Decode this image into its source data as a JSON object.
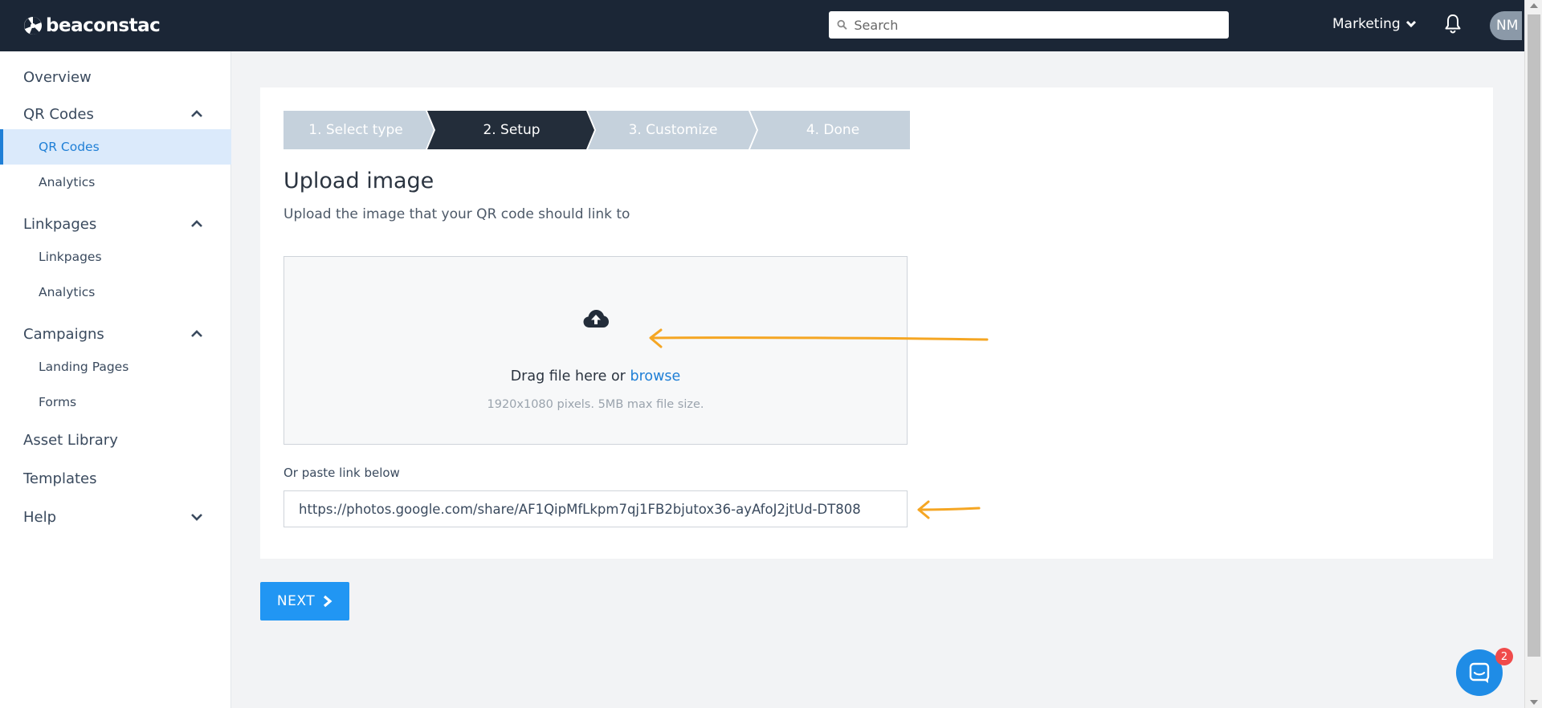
{
  "app": {
    "brand": "beaconstac"
  },
  "header": {
    "search_placeholder": "Search",
    "org_name": "Marketing",
    "avatar_initials": "NM",
    "icons": [
      "search-icon",
      "chevron-down-icon",
      "bell-icon"
    ]
  },
  "sidebar": {
    "items": [
      {
        "label": "Overview"
      },
      {
        "label": "QR Codes",
        "expanded": true,
        "children": [
          {
            "label": "QR Codes",
            "active": true
          },
          {
            "label": "Analytics"
          }
        ]
      },
      {
        "label": "Linkpages",
        "expanded": true,
        "children": [
          {
            "label": "Linkpages"
          },
          {
            "label": "Analytics"
          }
        ]
      },
      {
        "label": "Campaigns",
        "expanded": true,
        "children": [
          {
            "label": "Landing Pages"
          },
          {
            "label": "Forms"
          }
        ]
      },
      {
        "label": "Asset Library"
      },
      {
        "label": "Templates"
      },
      {
        "label": "Help",
        "expanded": false
      }
    ]
  },
  "steps": [
    {
      "label": "1. Select type",
      "state": "done"
    },
    {
      "label": "2. Setup",
      "state": "active"
    },
    {
      "label": "3. Customize",
      "state": "pending"
    },
    {
      "label": "4. Done",
      "state": "pending"
    }
  ],
  "upload": {
    "title": "Upload image",
    "subtitle": "Upload the image that your QR code should link to",
    "drag_text": "Drag file here or",
    "browse_label": "browse",
    "size_hint": "1920x1080 pixels. 5MB max file size.",
    "paste_label": "Or paste link below",
    "paste_value": "https://photos.google.com/share/AF1QipMfLkpm7qj1FB2bjutox36-ayAfoJ2jtUd-DT808"
  },
  "actions": {
    "next_label": "NEXT"
  },
  "chat": {
    "badge_count": "2"
  },
  "colors": {
    "topbar": "#1b2636",
    "accent": "#2196f3",
    "link": "#1f7fd6",
    "step_active": "#232d3a",
    "step_inactive": "#c5d1dc",
    "annotation_arrow": "#f5a623",
    "badge": "#f04b4b"
  }
}
